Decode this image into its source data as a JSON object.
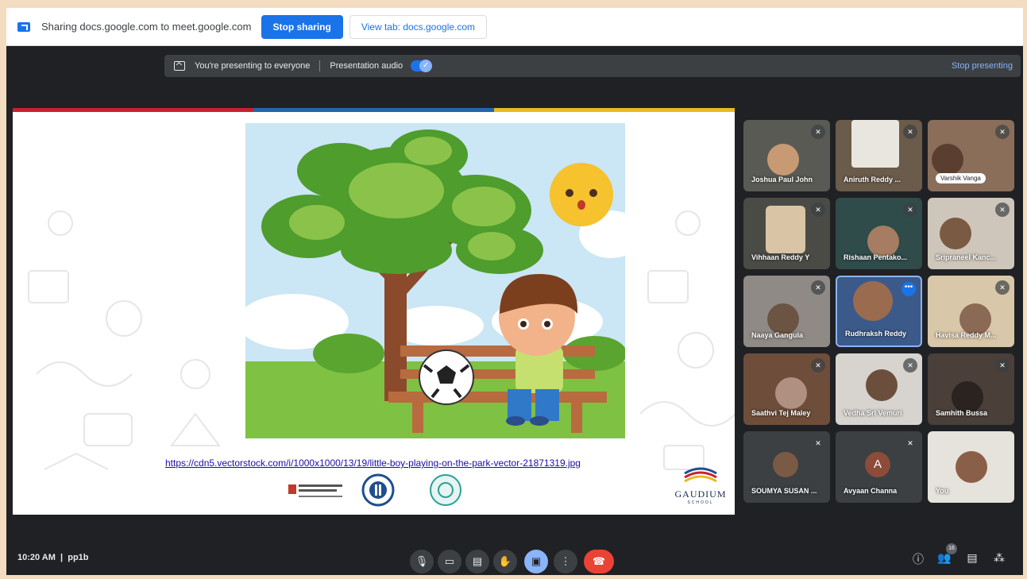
{
  "share_bar": {
    "text": "Sharing docs.google.com to meet.google.com",
    "stop_label": "Stop sharing",
    "view_tab_label": "View tab: docs.google.com"
  },
  "presenting_bar": {
    "text": "You're presenting to everyone",
    "audio_label": "Presentation audio",
    "stop_label": "Stop presenting"
  },
  "slide": {
    "link": "https://cdn5.vectorstock.com/i/1000x1000/13/19/little-boy-playing-on-the-park-vector-21871319.jpg",
    "school_name": "GAUDIUM",
    "school_sub": "SCHOOL",
    "stripe_colors": [
      "#c8202f",
      "#2167ac",
      "#e8b923"
    ]
  },
  "participants": [
    {
      "name": "Joshua Paul John"
    },
    {
      "name": "Aniruth Reddy ..."
    },
    {
      "name": "Varshik Vanga"
    },
    {
      "name": "Vihhaan Reddy Y"
    },
    {
      "name": "Rishaan Pentako..."
    },
    {
      "name": "Sripraneel Kanc..."
    },
    {
      "name": "Naaya Gangula"
    },
    {
      "name": "Rudhraksh Reddy"
    },
    {
      "name": "Havisa Reddy M..."
    },
    {
      "name": "Saathvi Tej Maley"
    },
    {
      "name": "Vedha Sri Vemuri"
    },
    {
      "name": "Samhith Bussa"
    },
    {
      "name": "SOUMYA SUSAN ..."
    },
    {
      "name": "Avyaan Channa",
      "initial": "A"
    },
    {
      "name": "You"
    }
  ],
  "controls": {
    "time": "10:20 AM",
    "meeting_code": "pp1b",
    "people_count": "16"
  },
  "colors": {
    "meet_bg": "#202124",
    "accent": "#1a73e8",
    "hangup": "#ea4335"
  }
}
